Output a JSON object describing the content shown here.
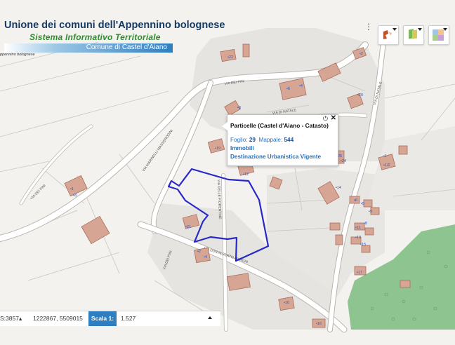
{
  "header": {
    "title": "Unione dei comuni dell'Appennino bolognese",
    "subtitle": "Sistema Informativo Territoriale",
    "comune": "Comune di Castel d'Aiano",
    "union_small": "ppennino bolognese"
  },
  "toolbar": {
    "buttons": [
      "tools-icon",
      "layers-icon",
      "basemap-icon"
    ]
  },
  "popup": {
    "title": "Particelle (Castel d'Aiano - Catasto)",
    "foglio_label": "Foglio:",
    "foglio_value": "29",
    "mappale_label": "Mappale:",
    "mappale_value": "544",
    "immobili": "Immobili",
    "destinazione": "Destinazione Urbanistica Vigente",
    "pin_icon": "⏻",
    "close_icon": "✕"
  },
  "statusbar": {
    "srs": "S:3857▴",
    "coords": "1222867, 5509015",
    "scale_label": "Scala 1:",
    "scale_value": "1.527"
  },
  "map": {
    "road_labels": [
      "VIA DEI PINI",
      "VIA DI NATALE",
      "VIA DELLE FIORENTINE",
      "VIA DON ALBERTO MARCHI",
      "VIA MARINELLI MASSERODINI",
      "VIA DEI PINI",
      "VIA DEI PINI",
      "VIA DI NATALE"
    ],
    "house_numbers": [
      "22",
      "2",
      "4",
      "6",
      "20",
      "8",
      "1",
      "3",
      "19",
      "12",
      "26",
      "24",
      "14",
      "1",
      "1/2",
      "21",
      "2",
      "4",
      "6",
      "5",
      "11",
      "8",
      "9",
      "13",
      "15",
      "17",
      "16",
      "10"
    ],
    "colors": {
      "background": "#f5f3ef",
      "parcel_outline": "#2929c9",
      "building": "#d7a594",
      "green": "#8ec48f",
      "road": "#ffffff"
    }
  }
}
